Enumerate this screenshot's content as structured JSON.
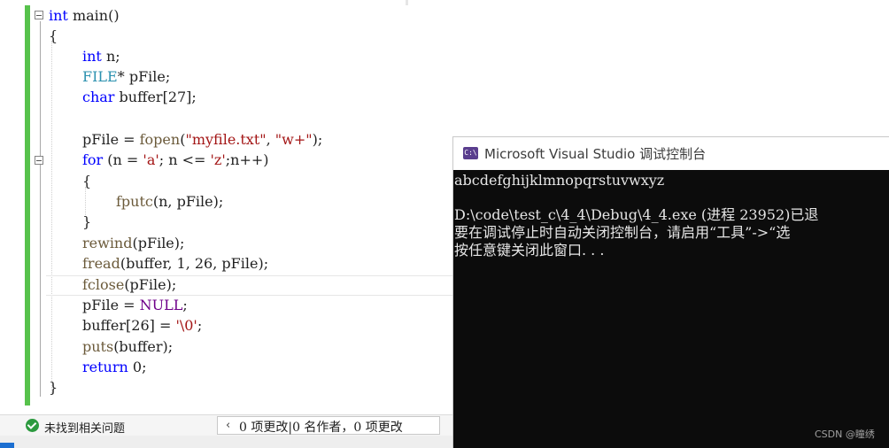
{
  "editor": {
    "lines": [
      {
        "parts": [
          {
            "t": "int",
            "c": "kw"
          },
          {
            "t": " main()",
            "c": "tx"
          }
        ]
      },
      {
        "parts": [
          {
            "t": "{",
            "c": "tx"
          }
        ]
      },
      {
        "parts": [
          {
            "t": "int",
            "c": "kw"
          },
          {
            "t": " n;",
            "c": "tx"
          }
        ]
      },
      {
        "parts": [
          {
            "t": "FILE",
            "c": "ty"
          },
          {
            "t": "* pFile;",
            "c": "tx"
          }
        ]
      },
      {
        "parts": [
          {
            "t": "char",
            "c": "kw"
          },
          {
            "t": " buffer[27];",
            "c": "tx"
          }
        ]
      },
      {
        "parts": []
      },
      {
        "parts": [
          {
            "t": "pFile = ",
            "c": "tx"
          },
          {
            "t": "fopen",
            "c": "fn"
          },
          {
            "t": "(",
            "c": "tx"
          },
          {
            "t": "\"myfile.txt\"",
            "c": "str"
          },
          {
            "t": ", ",
            "c": "tx"
          },
          {
            "t": "\"w+\"",
            "c": "str"
          },
          {
            "t": ");",
            "c": "tx"
          }
        ]
      },
      {
        "parts": [
          {
            "t": "for",
            "c": "kw"
          },
          {
            "t": " (n = ",
            "c": "tx"
          },
          {
            "t": "'a'",
            "c": "str"
          },
          {
            "t": "; n <= ",
            "c": "tx"
          },
          {
            "t": "'z'",
            "c": "str"
          },
          {
            "t": ";n++)",
            "c": "tx"
          }
        ]
      },
      {
        "parts": [
          {
            "t": "{",
            "c": "tx"
          }
        ]
      },
      {
        "parts": [
          {
            "t": "fputc",
            "c": "fn"
          },
          {
            "t": "(n, pFile);",
            "c": "tx"
          }
        ]
      },
      {
        "parts": [
          {
            "t": "}",
            "c": "tx"
          }
        ]
      },
      {
        "parts": [
          {
            "t": "rewind",
            "c": "fn"
          },
          {
            "t": "(pFile);",
            "c": "tx"
          }
        ]
      },
      {
        "parts": [
          {
            "t": "fread",
            "c": "fn"
          },
          {
            "t": "(buffer, 1, 26, pFile);",
            "c": "tx"
          }
        ]
      },
      {
        "parts": [
          {
            "t": "fclose",
            "c": "fn"
          },
          {
            "t": "(pFile);",
            "c": "tx"
          }
        ]
      },
      {
        "parts": [
          {
            "t": "pFile = ",
            "c": "tx"
          },
          {
            "t": "NULL",
            "c": "mac"
          },
          {
            "t": ";",
            "c": "tx"
          }
        ]
      },
      {
        "parts": [
          {
            "t": "buffer[26] = ",
            "c": "tx"
          },
          {
            "t": "'\\0'",
            "c": "str"
          },
          {
            "t": ";",
            "c": "tx"
          }
        ]
      },
      {
        "parts": [
          {
            "t": "puts",
            "c": "fn"
          },
          {
            "t": "(buffer);",
            "c": "tx"
          }
        ]
      },
      {
        "parts": [
          {
            "t": "return",
            "c": "kw"
          },
          {
            "t": " 0;",
            "c": "tx"
          }
        ]
      },
      {
        "parts": [
          {
            "t": "}",
            "c": "tx"
          }
        ]
      }
    ]
  },
  "status": {
    "issues_text": "未找到相关问题",
    "changes_text": "0 项更改|0 名作者，0 项更改"
  },
  "console": {
    "title": "Microsoft Visual Studio 调试控制台",
    "icon_text": "C:\\",
    "lines": [
      "abcdefghijklmnopqrstuvwxyz",
      "",
      "D:\\code\\test_c\\4_4\\Debug\\4_4.exe (进程 23952)已退",
      "要在调试停止时自动关闭控制台，请启用“工具”->“选",
      "按任意键关闭此窗口. . ."
    ],
    "watermark": "CSDN @瞳绣"
  },
  "colors": {
    "keyword": "#0000ff",
    "type": "#2b91af",
    "string": "#a31515",
    "macro": "#6f008a",
    "function": "#6b5a3a",
    "change_bar": "#57c24c",
    "status_ok": "#2c9a3f",
    "console_bg": "#0c0c0c"
  }
}
